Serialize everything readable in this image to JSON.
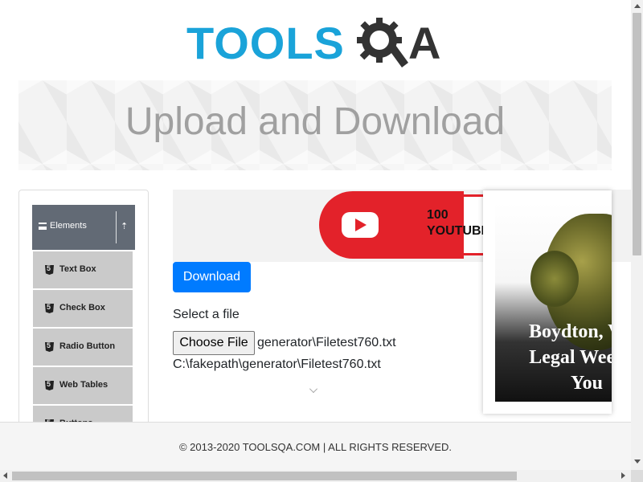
{
  "header": {
    "logo_text": "TOOLS",
    "logo_suffix": "A"
  },
  "banner": {
    "title": "Upload and Download"
  },
  "sidebar": {
    "group": {
      "label": "Elements"
    },
    "items": [
      {
        "label": "Text Box"
      },
      {
        "label": "Check Box"
      },
      {
        "label": "Radio Button"
      },
      {
        "label": "Web Tables"
      },
      {
        "label": "Buttons"
      }
    ]
  },
  "ad_strip": {
    "text_line1": "100",
    "text_line2": "YOUTUBE"
  },
  "main": {
    "download_label": "Download",
    "select_file_label": "Select a file",
    "choose_file_label": "Choose File",
    "chosen_file_name": "generator\\Filetest760.txt",
    "uploaded_path": "C:\\fakepath\\generator\\Filetest760.txt"
  },
  "side_ad": {
    "line1": "Boydton, Virg",
    "line2": "Legal Weed D",
    "line3": "You"
  },
  "footer": {
    "text": "© 2013-2020 TOOLSQA.COM | ALL RIGHTS RESERVED."
  },
  "colors": {
    "accent": "#007bff",
    "logo_blue": "#1aa3d9",
    "sidebar_header": "#626a75",
    "menu_item_bg": "#cacaca",
    "youtube_red": "#e3222a"
  },
  "icons": {
    "menu": "hamburger-icon",
    "collapse": "collapse-icon",
    "item": "html5-icon",
    "expand": "chevron-down-icon"
  }
}
